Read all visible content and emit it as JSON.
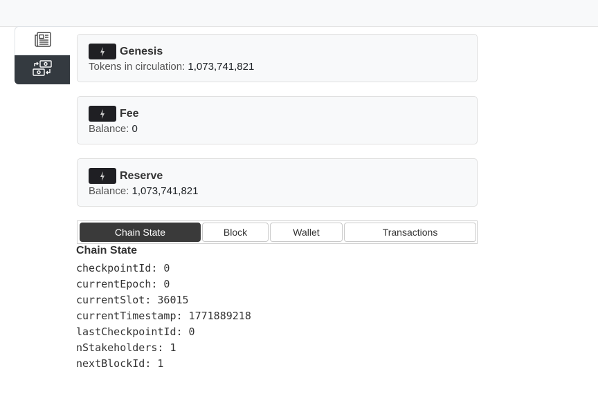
{
  "sidebar": {
    "items": [
      {
        "icon": "newspaper-icon",
        "active": false
      },
      {
        "icon": "cash-exchange-icon",
        "active": true
      }
    ]
  },
  "accounts": [
    {
      "name": "Genesis",
      "label": "Tokens in circulation:",
      "value": "1,073,741,821"
    },
    {
      "name": "Fee",
      "label": "Balance:",
      "value": "0"
    },
    {
      "name": "Reserve",
      "label": "Balance:",
      "value": "1,073,741,821"
    }
  ],
  "tabs": [
    {
      "label": "Chain State",
      "active": true
    },
    {
      "label": "Block",
      "active": false
    },
    {
      "label": "Wallet",
      "active": false
    },
    {
      "label": "Transactions",
      "active": false
    }
  ],
  "chain_state": {
    "title": "Chain State",
    "lines": [
      "checkpointId: 0",
      "currentEpoch: 0",
      "currentSlot: 36015",
      "currentTimestamp: 1771889218",
      "lastCheckpointId: 0",
      "nStakeholders: 1",
      "nextBlockId: 1"
    ]
  },
  "colors": {
    "active_tab": "#3a3a3a",
    "sidebar_active": "#343a40",
    "badge": "#1f1f23"
  }
}
